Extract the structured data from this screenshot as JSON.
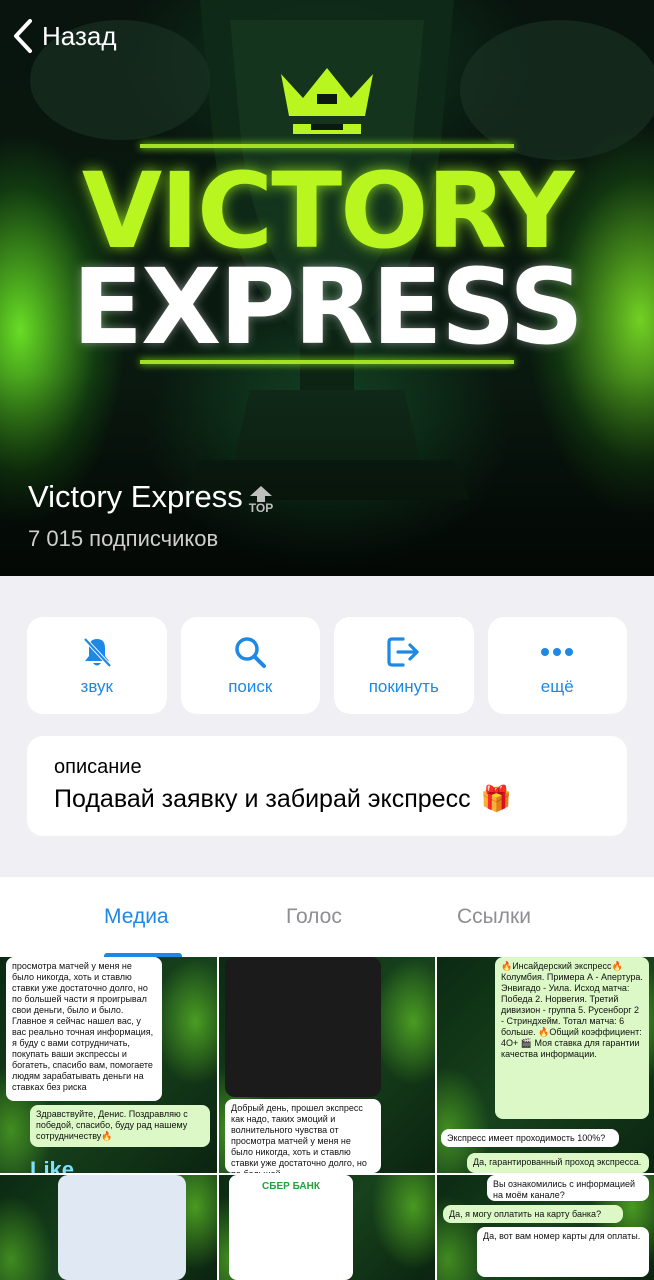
{
  "header": {
    "back_label": "Назад",
    "logo_line1": "VICTORY",
    "logo_line2": "EXPRESS",
    "channel_title": "Victory Express",
    "top_badge": "TOP",
    "subscribers": "7 015 подписчиков"
  },
  "actions": [
    {
      "label": "звук",
      "icon": "bell-slash-icon"
    },
    {
      "label": "поиск",
      "icon": "search-icon"
    },
    {
      "label": "покинуть",
      "icon": "leave-icon"
    },
    {
      "label": "ещё",
      "icon": "more-icon"
    }
  ],
  "description": {
    "label": "описание",
    "text": "Подавай заявку и забирай экспресс",
    "emoji": "🎁"
  },
  "tabs": [
    {
      "label": "Медиа",
      "active": true
    },
    {
      "label": "Голос",
      "active": false
    },
    {
      "label": "Ссылки",
      "active": false
    }
  ],
  "media": {
    "cell1": {
      "text1": "просмотра матчей у меня не было никогда, хоть и ставлю ставки уже достаточно долго, но по большей части я проигрывал свои деньги, было и было. Главное я сейчас нашел вас, у вас реально точная информация, я буду с вами сотрудничать, покупать ваши экспрессы и богатеть, спасибо вам, помогаете людям зарабатывать деньги на ставках без риска",
      "text2": "Здравствуйте, Денис. Поздравляю с победой, спасибо, буду рад нашему сотрудничеству🔥",
      "like": "Like"
    },
    "cell2": {
      "text": "Добрый день, прошел экспресс как надо, таких эмоций и волнительного чувства от просмотра матчей у меня не было никогда, хоть и ставлю ставки уже достаточно долго, но по большей"
    },
    "cell3": {
      "text1": "🔥Инсайдерский экспресс🔥 Колумбия. Примера А - Апертура. Энвигадо - Уила. Исход матча: Победа 2. Норвегия. Третий дивизион - группа 5. Русенборг 2 - Стриндхейм. Тотал матча: 6 больше. 🔥Общий коэффициент: 4О+ 🎬 Моя ставка для гарантии качества информации.",
      "text2": "Экспресс имеет проходимость 100%?",
      "text3": "Да, гарантированный проход экспресса.",
      "text4": "Вы ознакомились с информацией на моём канале?"
    },
    "cell5": {
      "bank": "СБЕР БАНК"
    },
    "cell6": {
      "text1": "Да, я могу оплатить на карту банка?",
      "text2": "Да, вот вам номер карты для оплаты."
    }
  }
}
